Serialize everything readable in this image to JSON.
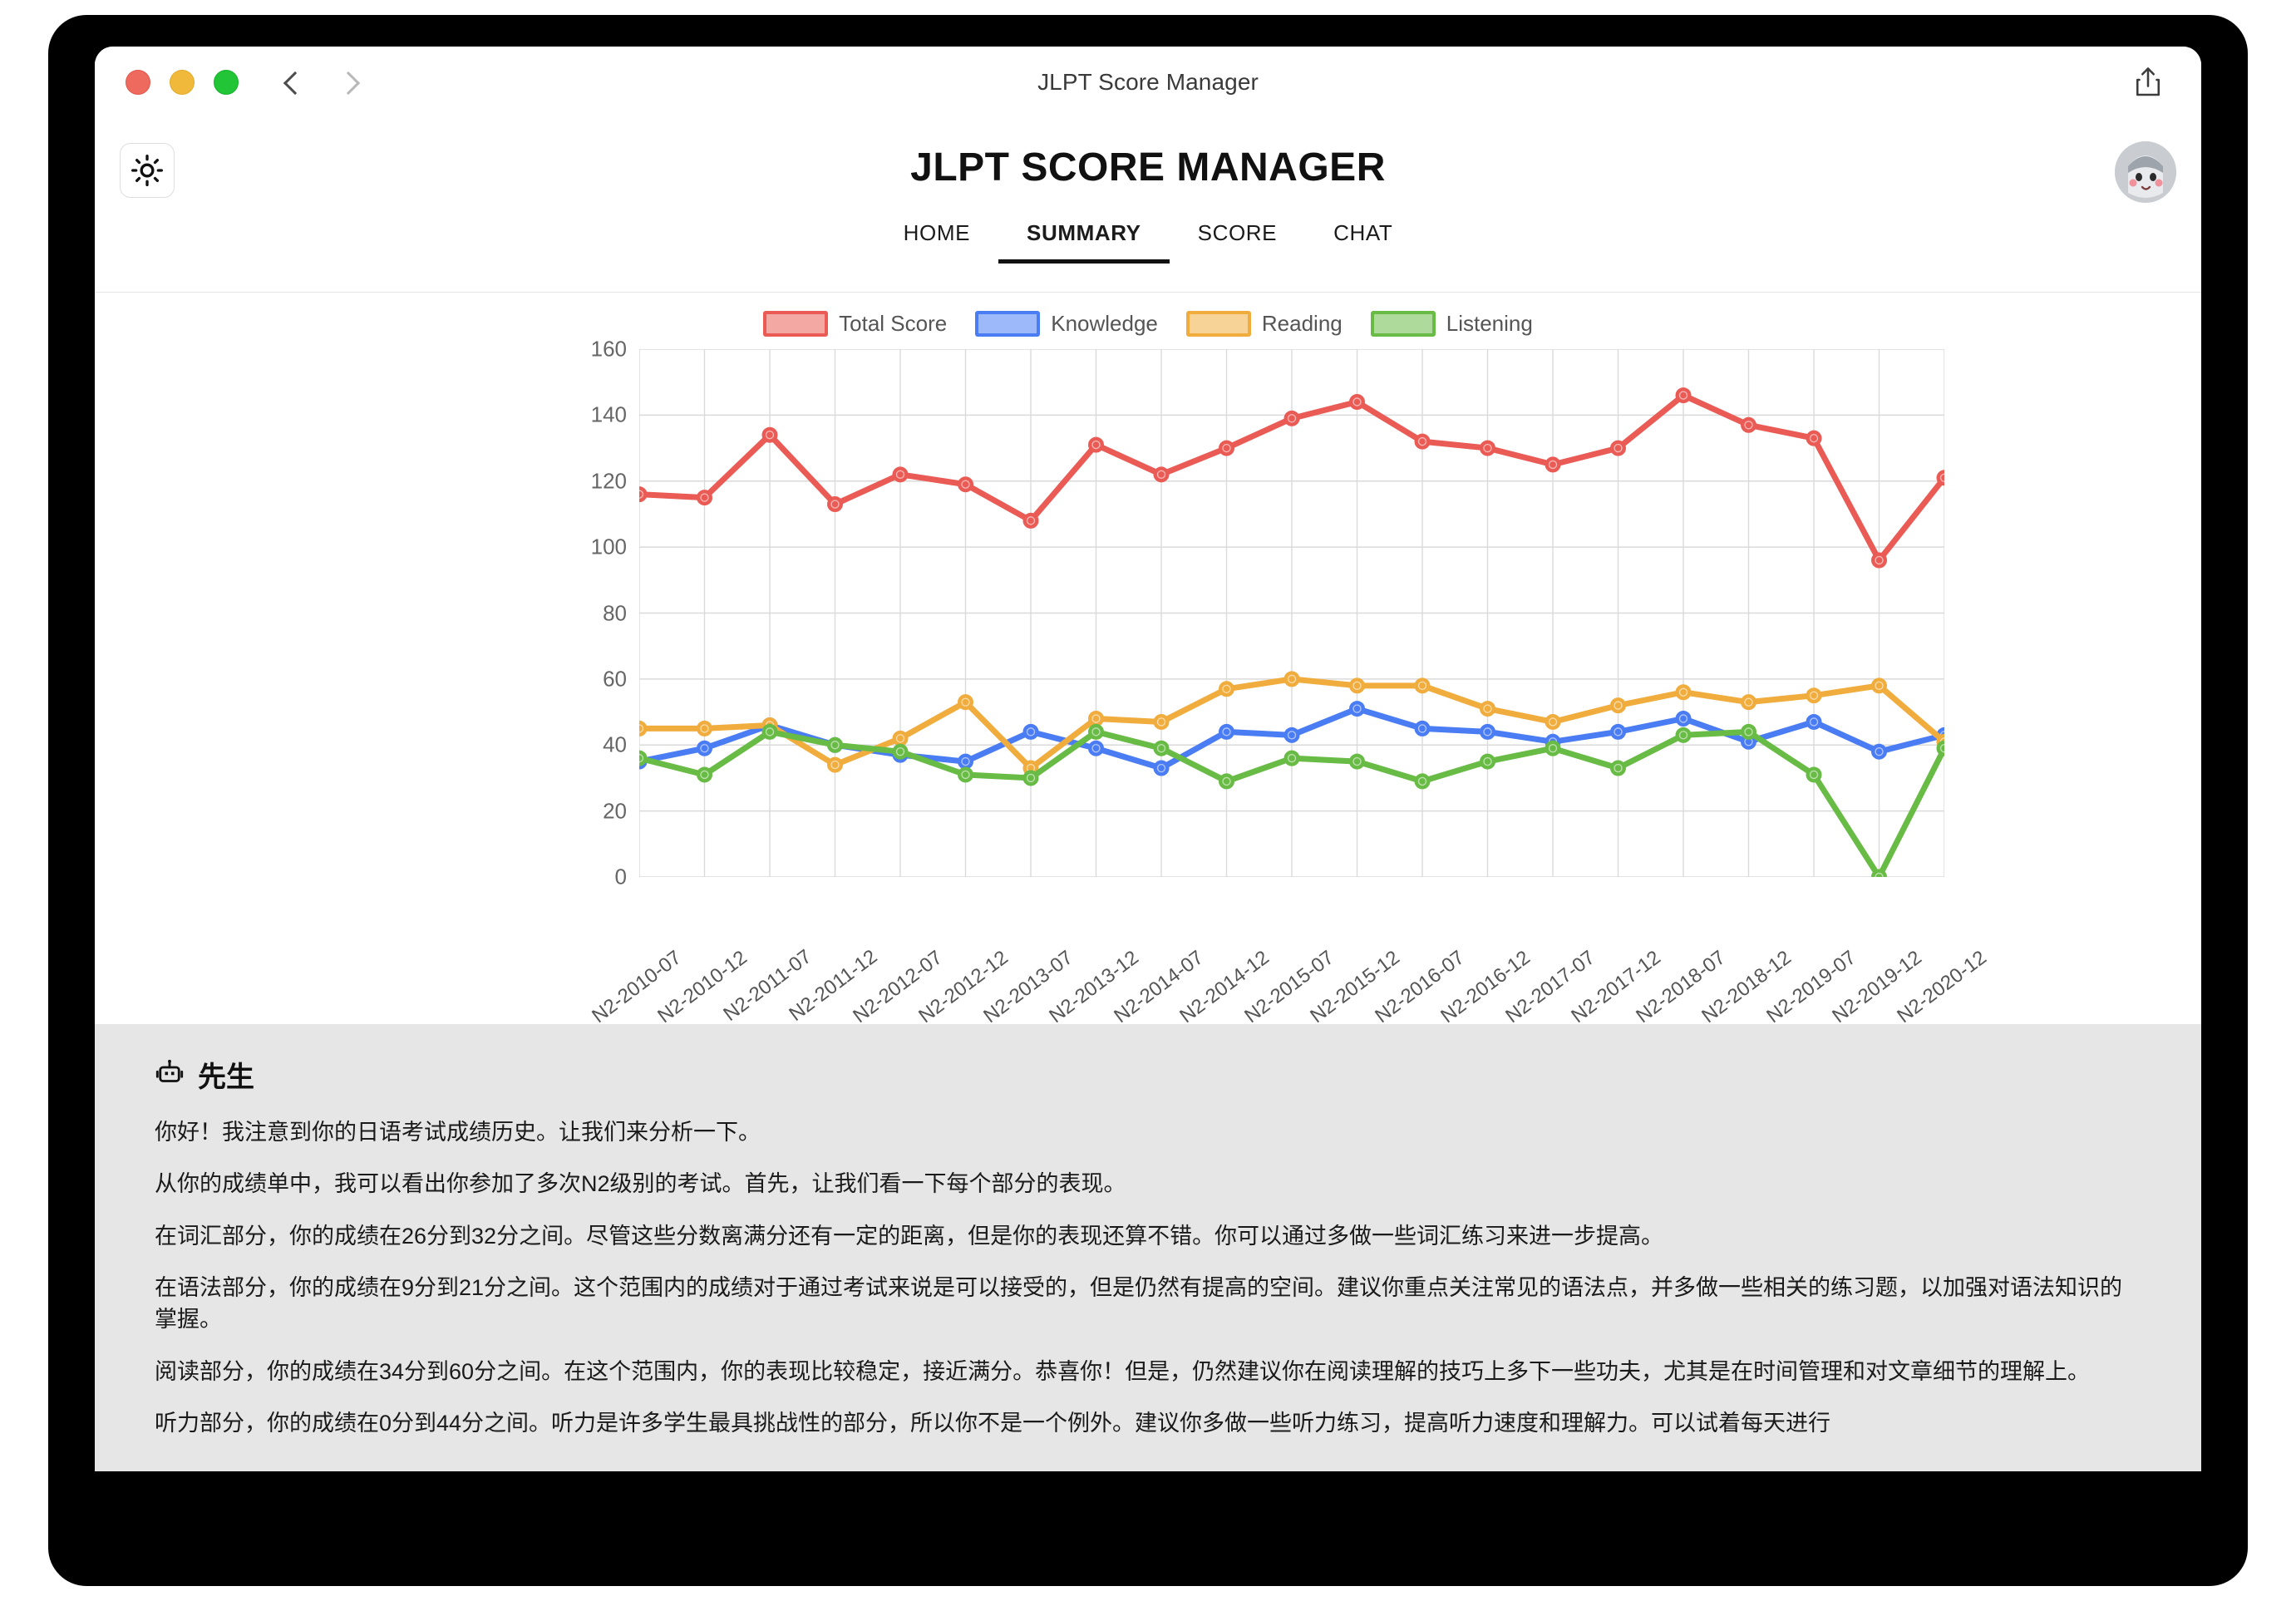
{
  "window": {
    "title": "JLPT Score Manager",
    "traffic_lights": [
      "close",
      "minimize",
      "zoom"
    ],
    "back_label": "Back",
    "forward_label": "Forward",
    "share_label": "Share"
  },
  "header": {
    "app_title": "JLPT SCORE MANAGER",
    "theme_toggle_name": "light-mode",
    "avatar_name": "user-avatar",
    "tabs": [
      {
        "label": "HOME",
        "active": false
      },
      {
        "label": "SUMMARY",
        "active": true
      },
      {
        "label": "SCORE",
        "active": false
      },
      {
        "label": "CHAT",
        "active": false
      }
    ]
  },
  "chart_data": {
    "type": "line",
    "title": "",
    "xlabel": "",
    "ylabel": "",
    "ylim": [
      0,
      160
    ],
    "yticks": [
      0,
      20,
      40,
      60,
      80,
      100,
      120,
      140,
      160
    ],
    "grid": true,
    "legend_position": "top-center",
    "categories": [
      "N2-2010-07",
      "N2-2010-12",
      "N2-2011-07",
      "N2-2011-12",
      "N2-2012-07",
      "N2-2012-12",
      "N2-2013-07",
      "N2-2013-12",
      "N2-2014-07",
      "N2-2014-12",
      "N2-2015-07",
      "N2-2015-12",
      "N2-2016-07",
      "N2-2016-12",
      "N2-2017-07",
      "N2-2017-12",
      "N2-2018-07",
      "N2-2018-12",
      "N2-2019-07",
      "N2-2019-12",
      "N2-2020-12"
    ],
    "series": [
      {
        "name": "Total Score",
        "color": "#EA5B55",
        "values": [
          116,
          115,
          134,
          113,
          122,
          119,
          108,
          131,
          122,
          130,
          139,
          144,
          132,
          130,
          125,
          130,
          146,
          137,
          133,
          96,
          121
        ]
      },
      {
        "name": "Knowledge",
        "color": "#4A7CF3",
        "values": [
          35,
          39,
          46,
          40,
          37,
          35,
          44,
          39,
          33,
          44,
          43,
          51,
          45,
          44,
          41,
          44,
          48,
          41,
          47,
          38,
          43
        ]
      },
      {
        "name": "Reading",
        "color": "#F0AD3E",
        "values": [
          45,
          45,
          46,
          34,
          42,
          53,
          33,
          48,
          47,
          57,
          60,
          58,
          58,
          51,
          47,
          52,
          56,
          53,
          55,
          58,
          41
        ]
      },
      {
        "name": "Listening",
        "color": "#68BB45",
        "values": [
          36,
          31,
          44,
          40,
          38,
          31,
          30,
          44,
          39,
          29,
          36,
          35,
          29,
          35,
          39,
          33,
          43,
          44,
          31,
          0,
          39
        ]
      }
    ]
  },
  "analysis": {
    "bot_icon_name": "robot-icon",
    "bot_name": "先生",
    "paragraphs": [
      "你好！我注意到你的日语考试成绩历史。让我们来分析一下。",
      "从你的成绩单中，我可以看出你参加了多次N2级别的考试。首先，让我们看一下每个部分的表现。",
      "在词汇部分，你的成绩在26分到32分之间。尽管这些分数离满分还有一定的距离，但是你的表现还算不错。你可以通过多做一些词汇练习来进一步提高。",
      "在语法部分，你的成绩在9分到21分之间。这个范围内的成绩对于通过考试来说是可以接受的，但是仍然有提高的空间。建议你重点关注常见的语法点，并多做一些相关的练习题，以加强对语法知识的掌握。",
      "阅读部分，你的成绩在34分到60分之间。在这个范围内，你的表现比较稳定，接近满分。恭喜你！但是，仍然建议你在阅读理解的技巧上多下一些功夫，尤其是在时间管理和对文章细节的理解上。",
      "听力部分，你的成绩在0分到44分之间。听力是许多学生最具挑战性的部分，所以你不是一个例外。建议你多做一些听力练习，提高听力速度和理解力。可以试着每天进行"
    ]
  }
}
